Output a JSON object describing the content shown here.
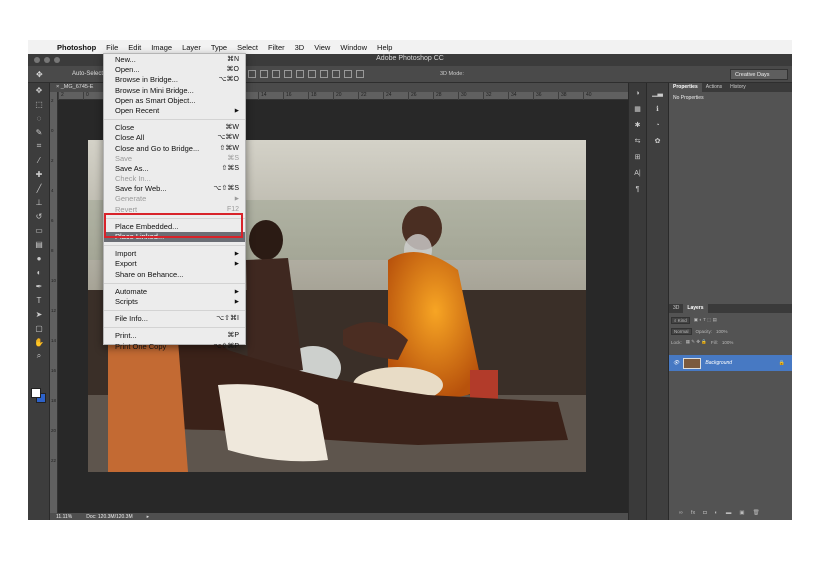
{
  "menubar": {
    "app_name": "Photoshop",
    "items": [
      "File",
      "Edit",
      "Image",
      "Layer",
      "Type",
      "Select",
      "Filter",
      "3D",
      "View",
      "Window",
      "Help"
    ]
  },
  "window": {
    "title": "Adobe Photoshop CC"
  },
  "options_bar": {
    "auto_select_label": "Auto-Select",
    "mode_3d_label": "3D Mode:",
    "workspace": "Creative Days"
  },
  "document": {
    "tab_name": "_MG_6745-E"
  },
  "ruler": {
    "h_ticks": [
      "2",
      "0",
      "2",
      "4",
      "6",
      "8",
      "10",
      "12",
      "14",
      "16",
      "18",
      "20",
      "22",
      "24",
      "26",
      "28",
      "30",
      "32",
      "34",
      "36",
      "38",
      "40"
    ],
    "v_ticks": [
      "2",
      "0",
      "2",
      "4",
      "6",
      "8",
      "10",
      "12",
      "14",
      "16",
      "18",
      "20",
      "22"
    ]
  },
  "status_bar": {
    "zoom": "11.11%",
    "doc_size": "Doc: 120.3M/120.3M"
  },
  "properties_panel": {
    "tabs": [
      "Properties",
      "Actions",
      "History"
    ],
    "active_tab": "Properties",
    "body": "No Properties"
  },
  "layers_panel": {
    "tabs": [
      "3D",
      "Layers"
    ],
    "active_tab": "Layers",
    "kind_label": "Kind",
    "blend_mode": "Normal",
    "opacity_label": "Opacity:",
    "opacity_value": "100%",
    "lock_label": "Lock:",
    "fill_label": "Fill:",
    "fill_value": "100%",
    "layer_name": "Background"
  },
  "file_menu": {
    "groups": [
      [
        {
          "label": "New...",
          "shortcut": "⌘N"
        },
        {
          "label": "Open...",
          "shortcut": "⌘O"
        },
        {
          "label": "Browse in Bridge...",
          "shortcut": "⌥⌘O"
        },
        {
          "label": "Browse in Mini Bridge...",
          "shortcut": ""
        },
        {
          "label": "Open as Smart Object...",
          "shortcut": ""
        },
        {
          "label": "Open Recent",
          "shortcut": "▶"
        }
      ],
      [
        {
          "label": "Close",
          "shortcut": "⌘W"
        },
        {
          "label": "Close All",
          "shortcut": "⌥⌘W"
        },
        {
          "label": "Close and Go to Bridge...",
          "shortcut": "⇧⌘W"
        },
        {
          "label": "Save",
          "shortcut": "⌘S"
        },
        {
          "label": "Save As...",
          "shortcut": "⇧⌘S"
        },
        {
          "label": "Check In...",
          "shortcut": ""
        },
        {
          "label": "Save for Web...",
          "shortcut": "⌥⇧⌘S"
        },
        {
          "label": "Generate",
          "shortcut": "▶"
        },
        {
          "label": "Revert",
          "shortcut": "F12"
        }
      ],
      [
        {
          "label": "Place Embedded...",
          "shortcut": ""
        },
        {
          "label": "Place Linked...",
          "shortcut": ""
        }
      ],
      [
        {
          "label": "Import",
          "shortcut": "▶"
        },
        {
          "label": "Export",
          "shortcut": "▶"
        },
        {
          "label": "Share on Behance...",
          "shortcut": ""
        }
      ],
      [
        {
          "label": "Automate",
          "shortcut": "▶"
        },
        {
          "label": "Scripts",
          "shortcut": "▶"
        }
      ],
      [
        {
          "label": "File Info...",
          "shortcut": "⌥⇧⌘I"
        }
      ],
      [
        {
          "label": "Print...",
          "shortcut": "⌘P"
        },
        {
          "label": "Print One Copy",
          "shortcut": "⌥⇧⌘P"
        }
      ]
    ],
    "disabled": [
      "Save",
      "Check In...",
      "Generate",
      "Revert"
    ],
    "highlighted": "Place Linked...",
    "callout_color": "#d8232a"
  }
}
